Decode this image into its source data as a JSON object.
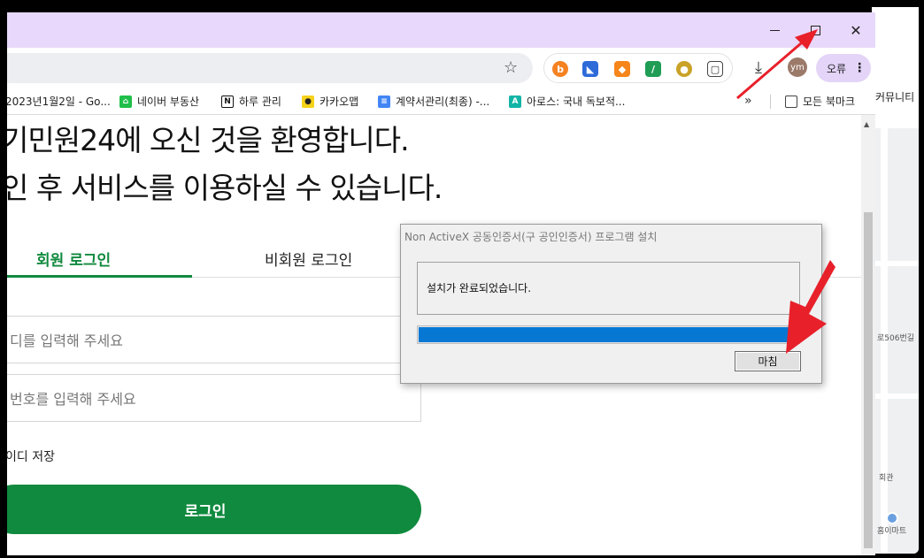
{
  "background_window": {
    "community_label": "커뮤니티",
    "map_labels": [
      "로506번길",
      "회관",
      "홈이마트"
    ]
  },
  "window": {
    "title_bg": "#e8d8fb",
    "minimize_icon": "minimize-icon",
    "maximize_icon": "maximize-icon",
    "close_glyph": "✕"
  },
  "toolbar": {
    "star_glyph": "☆",
    "download_glyph": "⤓",
    "avatar_text": "ym",
    "error_label": "오류",
    "menu_glyph": "⋮"
  },
  "bookmarks": [
    {
      "label": "2023년1월2일 - Go...",
      "icon": "page-icon"
    },
    {
      "label": "네이버 부동산",
      "icon": "naver-home-icon"
    },
    {
      "label": "하루 관리",
      "icon": "notion-icon"
    },
    {
      "label": "카카오맵",
      "icon": "map-pin-icon"
    },
    {
      "label": "계약서관리(최종) -...",
      "icon": "docs-icon"
    },
    {
      "label": "아로스: 국내 독보적...",
      "icon": "aros-icon"
    },
    {
      "label": "모든 북마크",
      "icon": "folder-icon"
    }
  ],
  "bookmarks_more": "»",
  "page": {
    "welcome_line1": "기민원24에 오신 것을 환영합니다.",
    "welcome_line2": "인 후 서비스를 이용하실 수 있습니다.",
    "tab_member": "회원 로그인",
    "tab_guest": "비회원 로그인",
    "id_placeholder": "디를 입력해 주세요",
    "pw_placeholder": "번호를 입력해 주세요",
    "save_id_label": "이디 저장",
    "login_button": "로그인",
    "accent_color": "#108a3e"
  },
  "dialog": {
    "title": "Non ActiveX 공동인증서(구 공인인증서) 프로그램 설치",
    "message": "설치가 완료되었습니다.",
    "progress": 1.0,
    "finish_button": "마침"
  },
  "annotation_color": "#e8202a"
}
